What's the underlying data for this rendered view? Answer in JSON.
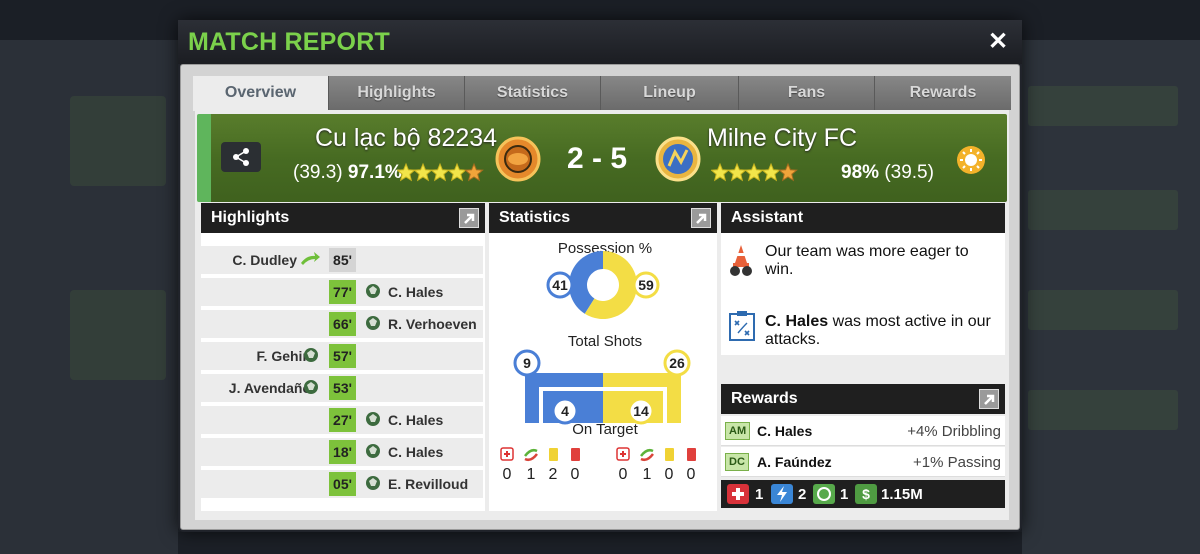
{
  "window": {
    "title": "MATCH REPORT",
    "close_glyph": "✕"
  },
  "tabs": [
    {
      "label": "Overview",
      "active": true
    },
    {
      "label": "Highlights",
      "active": false
    },
    {
      "label": "Statistics",
      "active": false
    },
    {
      "label": "Lineup",
      "active": false
    },
    {
      "label": "Fans",
      "active": false
    },
    {
      "label": "Rewards",
      "active": false
    }
  ],
  "match": {
    "home": {
      "name": "Cu lạc bộ 82234",
      "rating": "(39.3)",
      "percent": "97.1%",
      "stars": 4.5
    },
    "away": {
      "name": "Milne City FC",
      "rating": "(39.5)",
      "percent": "98%",
      "stars": 4.5
    },
    "score": "2 - 5",
    "weather_icon": "sun-icon",
    "share_icon": "share-icon"
  },
  "highlights": {
    "title": "Highlights",
    "rows": [
      {
        "side": "home",
        "minute": "85'",
        "player": "C. Dudley",
        "event": "substitution",
        "minute_style": "gray"
      },
      {
        "side": "away",
        "minute": "77'",
        "player": "C. Hales",
        "event": "goal",
        "minute_style": "green"
      },
      {
        "side": "away",
        "minute": "66'",
        "player": "R. Verhoeven",
        "event": "goal",
        "minute_style": "green"
      },
      {
        "side": "home",
        "minute": "57'",
        "player": "F. Gehin",
        "event": "goal",
        "minute_style": "green"
      },
      {
        "side": "home",
        "minute": "53'",
        "player": "J. Avendaño",
        "event": "goal",
        "minute_style": "green"
      },
      {
        "side": "away",
        "minute": "27'",
        "player": "C. Hales",
        "event": "goal",
        "minute_style": "green"
      },
      {
        "side": "away",
        "minute": "18'",
        "player": "C. Hales",
        "event": "goal",
        "minute_style": "green"
      },
      {
        "side": "away",
        "minute": "05'",
        "player": "E. Revilloud",
        "event": "goal",
        "minute_style": "green"
      }
    ]
  },
  "statistics": {
    "title": "Statistics",
    "possession_label": "Possession %",
    "possession_home": 41,
    "possession_away": 59,
    "shots_label": "Total Shots",
    "shots_home": 9,
    "shots_away": 26,
    "on_target_label": "On Target",
    "on_target_home": 4,
    "on_target_away": 14,
    "home_cards": [
      "0",
      "1",
      "2",
      "0"
    ],
    "away_cards": [
      "0",
      "1",
      "0",
      "0"
    ],
    "card_icons": [
      "injury-icon",
      "substitution-icon",
      "yellow-card-icon",
      "red-card-icon"
    ],
    "colors": {
      "home": "#4a7fd6",
      "away": "#f3dd45"
    }
  },
  "assistant": {
    "title": "Assistant",
    "message_1": "Our team was more eager to win.",
    "message_2_player": "C. Hales",
    "message_2_rest_1": " was most active in our",
    "message_2_rest_2": "attacks."
  },
  "rewards": {
    "title": "Rewards",
    "rows": [
      {
        "tag": "AM",
        "name": "C. Hales",
        "value": "+4% Dribbling"
      },
      {
        "tag": "DC",
        "name": "A. Faúndez",
        "value": "+1% Passing"
      }
    ],
    "totals": {
      "medical": "1",
      "energy": "2",
      "bucks": "1",
      "money": "1.15M"
    }
  }
}
